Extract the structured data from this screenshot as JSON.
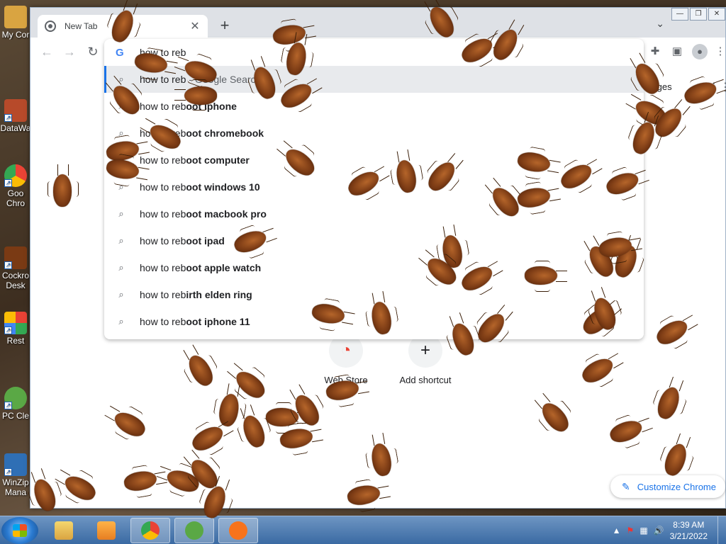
{
  "desktop": {
    "icons": [
      {
        "label": "My Cor",
        "color": "#d9a441"
      },
      {
        "label": "DataWa",
        "color": "#b74a2a"
      },
      {
        "label": "Goo",
        "label2": "Chro",
        "color": "#4285f4"
      },
      {
        "label": "Cockro",
        "label2": "Desk",
        "color": "#7a3a14"
      },
      {
        "label": "Rest",
        "color": "#e94235"
      },
      {
        "label": "PC Cle",
        "color": "#5aa845"
      },
      {
        "label": "WinZip",
        "label2": "Mana",
        "color": "#2f6fb5"
      }
    ]
  },
  "browser": {
    "tab_title": "New Tab",
    "tab_close": "✕",
    "new_tab": "+",
    "tab_search": "⌄",
    "window_controls": [
      "—",
      "❐",
      "✕"
    ],
    "nav": {
      "back": "←",
      "forward": "→",
      "reload": "↻"
    },
    "tools": {
      "extensions": "✚",
      "sidebar": "▣",
      "profile": "●",
      "menu": "⋮"
    }
  },
  "omnibox": {
    "logo": "G",
    "input_text": "how to reb",
    "suggestions": [
      {
        "typed": "how to reb",
        "rest": "",
        "hint": "- Google Search",
        "selected": true
      },
      {
        "typed": "how to reb",
        "rest": "oot iphone"
      },
      {
        "typed": "how to reb",
        "rest": "oot chromebook"
      },
      {
        "typed": "how to reb",
        "rest": "oot computer"
      },
      {
        "typed": "how to reb",
        "rest": "oot windows 10"
      },
      {
        "typed": "how to reb",
        "rest": "oot macbook pro"
      },
      {
        "typed": "how to reb",
        "rest": "oot ipad"
      },
      {
        "typed": "how to reb",
        "rest": "oot apple watch"
      },
      {
        "typed": "how to reb",
        "rest": "irth elden ring"
      },
      {
        "typed": "how to reb",
        "rest": "oot iphone 11"
      }
    ]
  },
  "newtab_page": {
    "images_link": "Images",
    "apps_icon": "⋮⋮",
    "shortcuts": [
      {
        "label": "Web Store",
        "icon": "◔"
      },
      {
        "label": "Add shortcut",
        "icon": "+"
      }
    ],
    "customize_label": "Customize Chrome",
    "customize_icon": "✎"
  },
  "taskbar": {
    "apps": [
      "explorer",
      "media-player",
      "chrome",
      "pc-cleaner",
      "avast"
    ],
    "tray_icons": [
      "▲",
      "⚑",
      "▦",
      "🔊"
    ],
    "time": "8:39 AM",
    "date": "3/21/2022"
  },
  "colors": {
    "accent": "#1a73e8",
    "roach": "#7a3a14"
  }
}
